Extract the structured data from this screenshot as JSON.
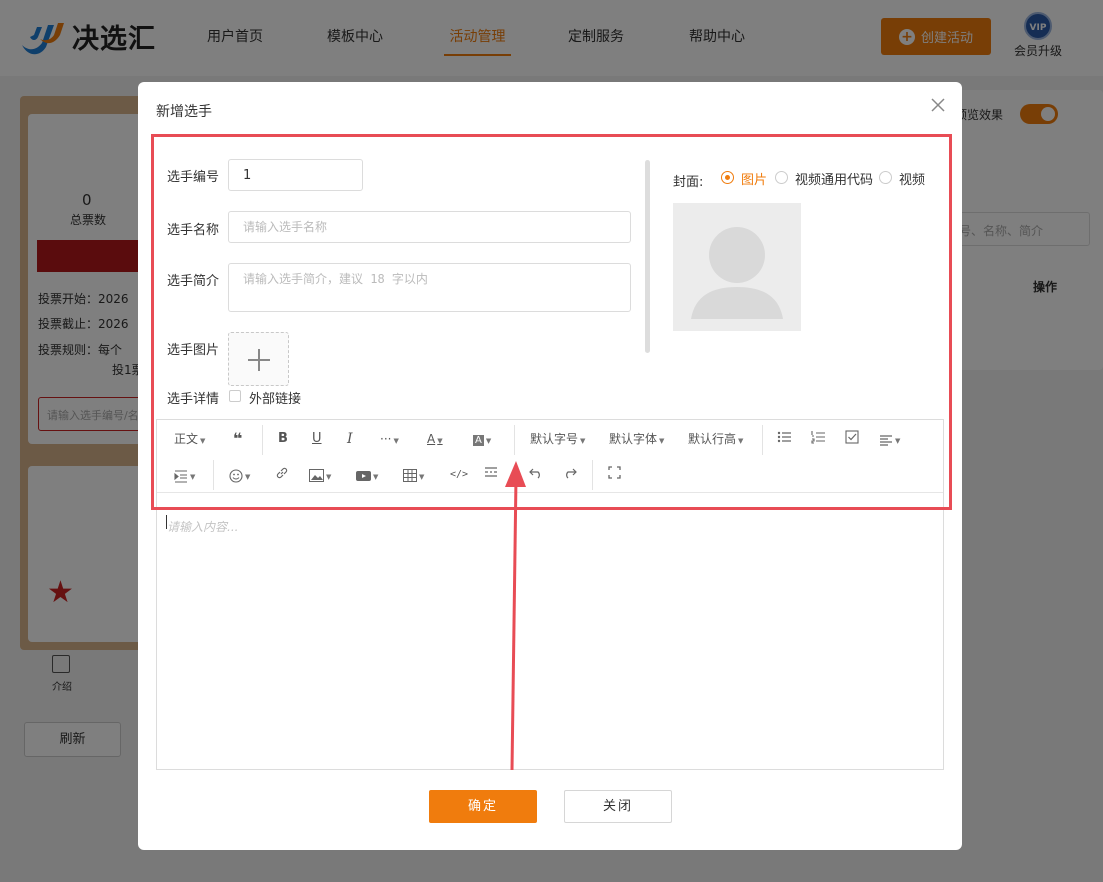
{
  "header": {
    "logo_text": "决选汇",
    "nav": [
      "用户首页",
      "模板中心",
      "活动管理",
      "定制服务",
      "帮助中心"
    ],
    "active_nav": "活动管理",
    "create_button": "创建活动",
    "vip_badge": "VIP",
    "vip_label": "会员升级"
  },
  "background": {
    "total_votes_value": "0",
    "total_votes_label": "总票数",
    "vote_start": "投票开始：2026",
    "vote_end": "投票截止：2026",
    "vote_rule": "投票规则：每个",
    "vote_rule_2": "投1票",
    "search_placeholder": "请输入选手编号/名",
    "preview_label": "预览效果",
    "right_search_placeholder": "号、名称、简介",
    "ops_header": "操作",
    "intro_tab": "介绍",
    "refresh_button": "刷新"
  },
  "modal": {
    "title": "新增选手",
    "fields": {
      "number_label": "选手编号",
      "number_value": "1",
      "name_label": "选手名称",
      "name_placeholder": "请输入选手名称",
      "intro_label": "选手简介",
      "intro_placeholder": "请输入选手简介，建议 18 字以内",
      "image_label": "选手图片",
      "detail_label": "选手详情",
      "external_link_label": "外部链接"
    },
    "cover": {
      "label": "封面:",
      "options": [
        "图片",
        "视频通用代码",
        "视频"
      ],
      "selected": "图片"
    },
    "editor": {
      "toolbar_row1": {
        "paragraph": "正文",
        "font_size": "默认字号",
        "font_family": "默认字体",
        "line_height": "默认行高",
        "more": "···"
      },
      "placeholder": "请输入内容..."
    },
    "confirm_button": "确定",
    "close_button": "关闭"
  },
  "colors": {
    "accent": "#f07c0d",
    "annotation": "#e84c55"
  }
}
